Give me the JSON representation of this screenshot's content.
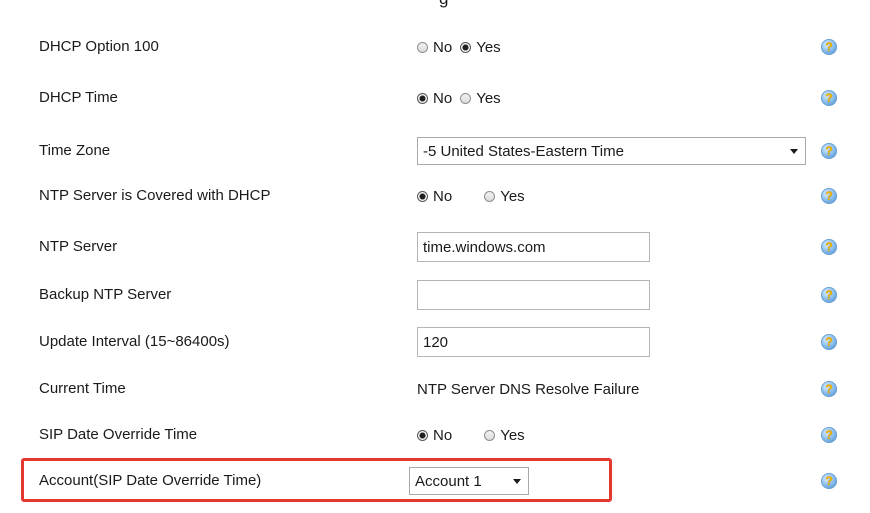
{
  "top_fragment": "g",
  "help_glyph": "?",
  "rows": [
    {
      "label": "DHCP Option 100",
      "no": "No",
      "yes": "Yes",
      "selected": "Yes"
    },
    {
      "label": "DHCP Time",
      "no": "No",
      "yes": "Yes",
      "selected": "No"
    },
    {
      "label": "Time Zone",
      "value": "-5 United States-Eastern Time"
    },
    {
      "label": "NTP Server is Covered with DHCP",
      "no": "No",
      "yes": "Yes",
      "selected": "No"
    },
    {
      "label": "NTP Server",
      "value": "time.windows.com"
    },
    {
      "label": "Backup NTP Server",
      "value": ""
    },
    {
      "label": "Update Interval (15~86400s)",
      "value": "120"
    },
    {
      "label": "Current Time",
      "value": "NTP Server DNS Resolve Failure"
    },
    {
      "label": "SIP Date Override Time",
      "no": "No",
      "yes": "Yes",
      "selected": "No"
    },
    {
      "label": "Account(SIP Date Override Time)",
      "value": "Account 1"
    }
  ],
  "colors": {
    "highlight_border": "#e4372f",
    "help_icon": "#3c7fc4"
  },
  "icons": {
    "help": "help-icon",
    "dropdown": "chevron-down-icon"
  }
}
